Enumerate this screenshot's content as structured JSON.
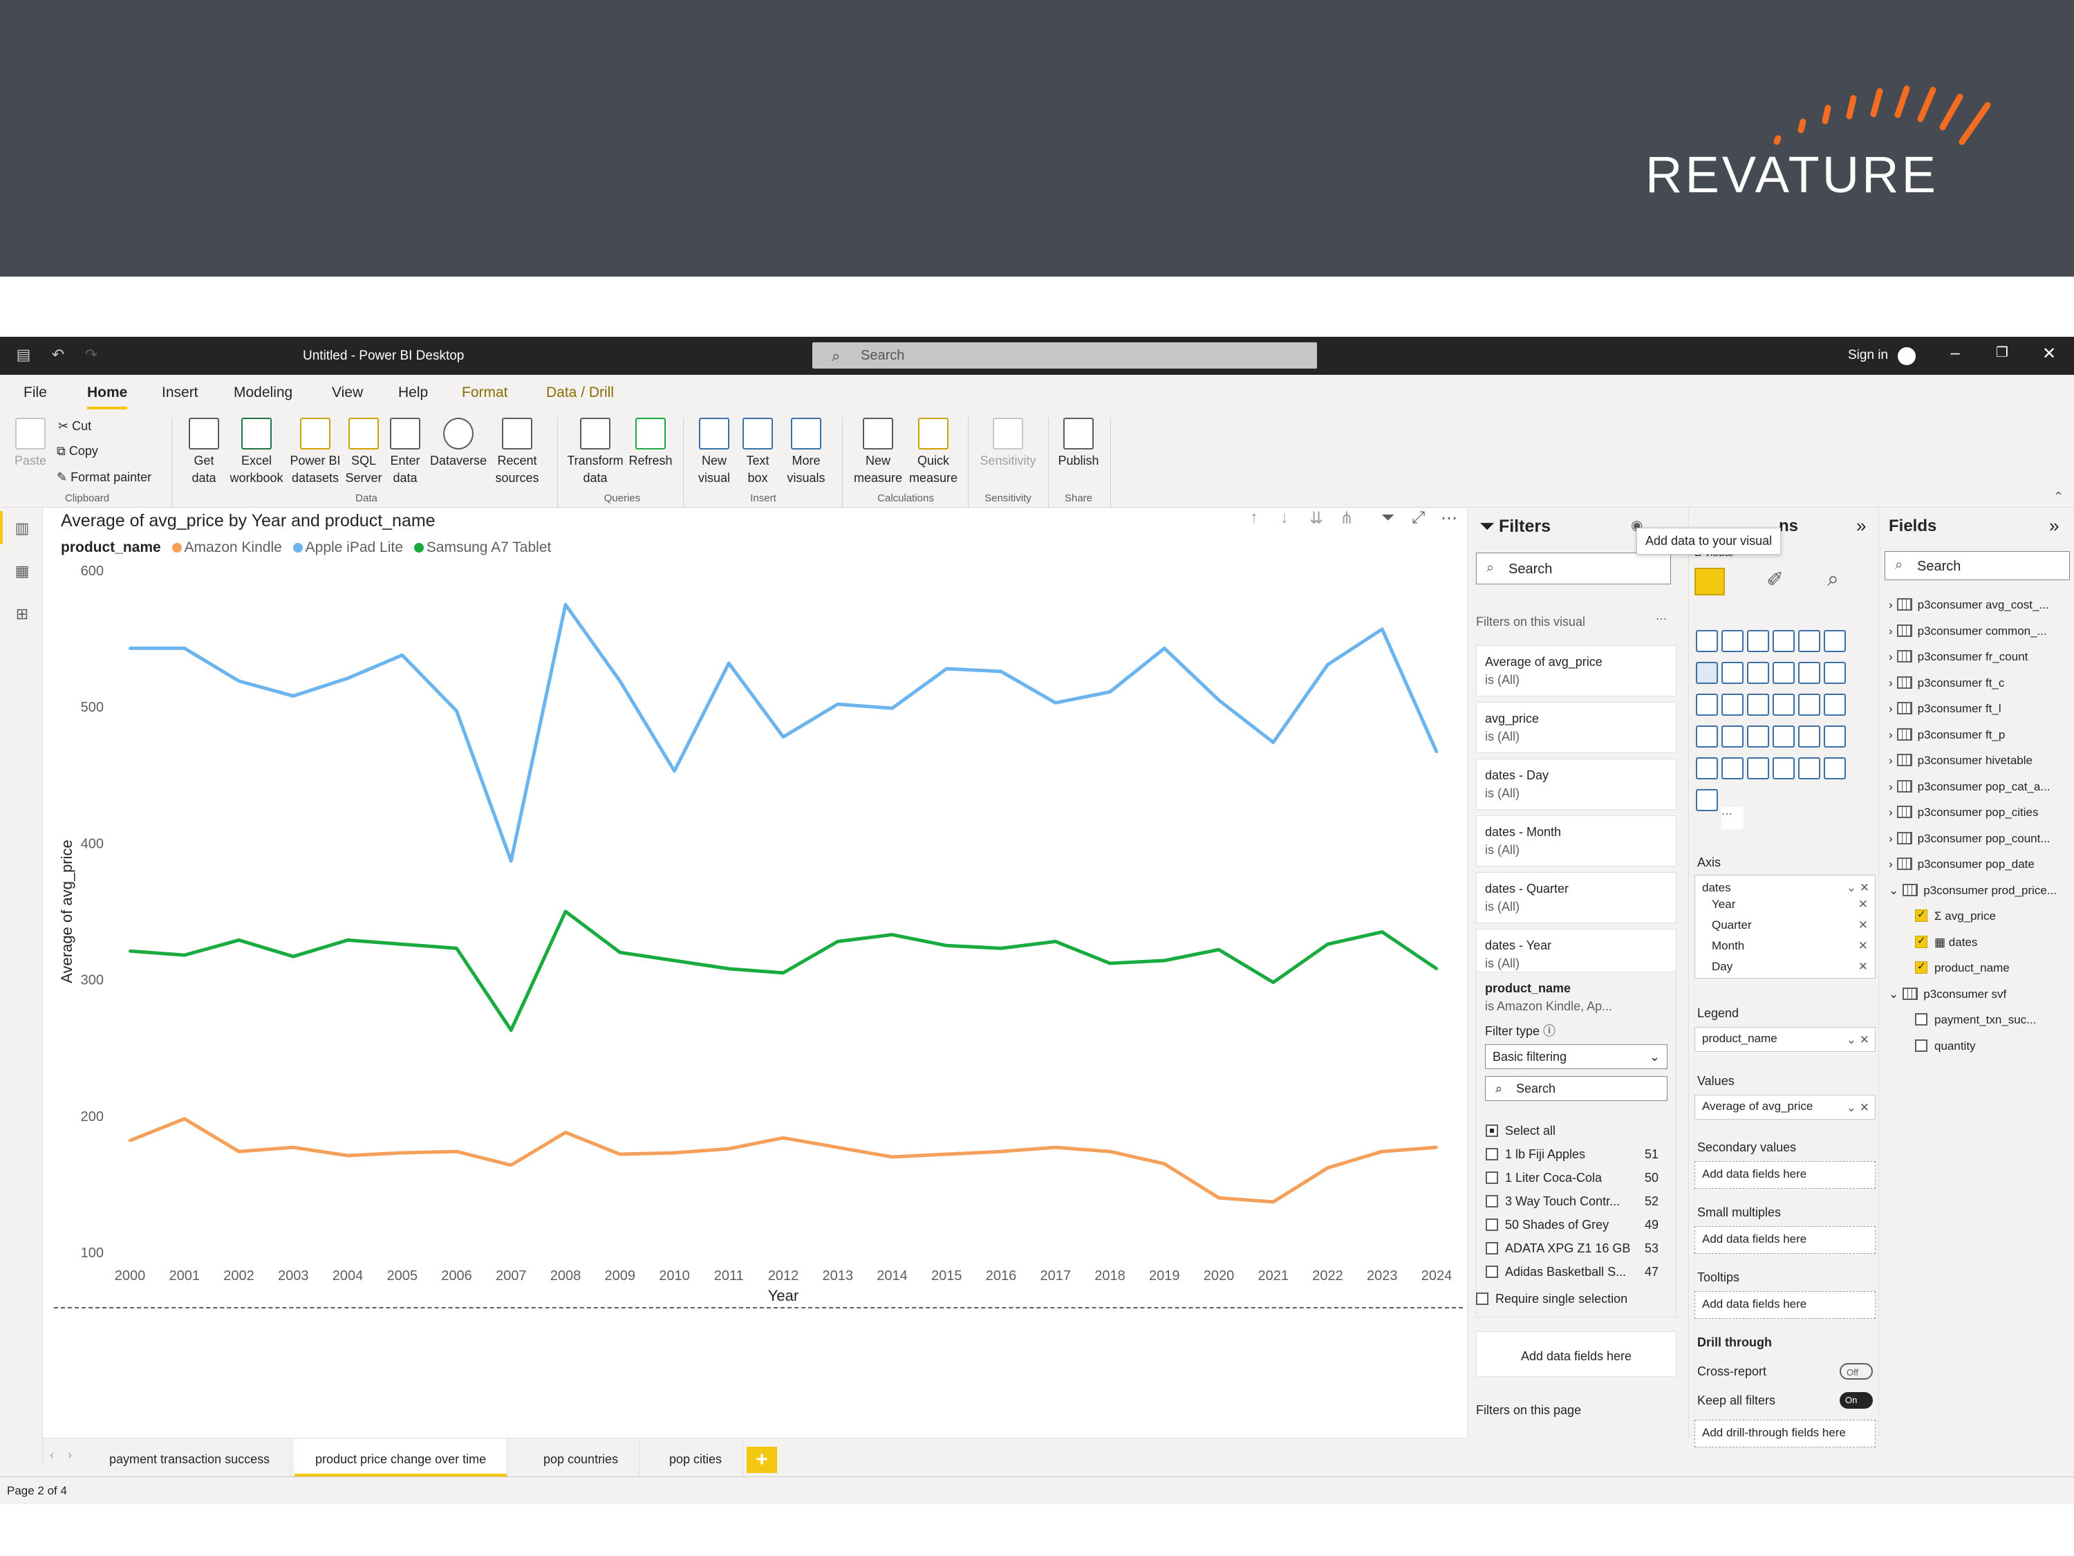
{
  "brand": {
    "name": "REVATURE",
    "colors": {
      "banner": "#464a52",
      "accent": "#f26d21"
    }
  },
  "titlebar": {
    "title": "Untitled - Power BI Desktop",
    "search_placeholder": "Search",
    "signin": "Sign in"
  },
  "menu": {
    "tabs": [
      "File",
      "Home",
      "Insert",
      "Modeling",
      "View",
      "Help",
      "Format",
      "Data / Drill"
    ],
    "active": "Home"
  },
  "ribbon": {
    "clipboard": {
      "paste": "Paste",
      "cut": "Cut",
      "copy": "Copy",
      "format_painter": "Format painter",
      "group": "Clipboard"
    },
    "data": {
      "items": [
        "Get data",
        "Excel workbook",
        "Power BI datasets",
        "SQL Server",
        "Enter data",
        "Dataverse",
        "Recent sources"
      ],
      "group": "Data"
    },
    "queries": {
      "items": [
        "Transform data",
        "Refresh"
      ],
      "group": "Queries"
    },
    "insert": {
      "items": [
        "New visual",
        "Text box",
        "More visuals"
      ],
      "group": "Insert"
    },
    "calculations": {
      "items": [
        "New measure",
        "Quick measure"
      ],
      "group": "Calculations"
    },
    "sensitivity": {
      "items": [
        "Sensitivity"
      ],
      "group": "Sensitivity"
    },
    "share": {
      "items": [
        "Publish"
      ],
      "group": "Share"
    }
  },
  "visual": {
    "title": "Average of avg_price by Year and product_name",
    "legend_title": "product_name",
    "legend_items": [
      "Amazon Kindle",
      "Apple iPad Lite",
      "Samsung A7 Tablet"
    ]
  },
  "chart_data": {
    "type": "line",
    "title": "Average of avg_price by Year and product_name",
    "xlabel": "Year",
    "ylabel": "Average of avg_price",
    "x": [
      2000,
      2001,
      2002,
      2003,
      2004,
      2005,
      2006,
      2007,
      2008,
      2009,
      2010,
      2011,
      2012,
      2013,
      2014,
      2015,
      2016,
      2017,
      2018,
      2019,
      2020,
      2021,
      2022,
      2023,
      2024
    ],
    "ylim": [
      100,
      600
    ],
    "yticks": [
      100,
      200,
      300,
      400,
      500,
      600
    ],
    "grid": false,
    "legend": "top-left",
    "series": [
      {
        "name": "Amazon Kindle",
        "color": "#f5a05a",
        "values": [
          182,
          198,
          174,
          177,
          171,
          173,
          174,
          164,
          188,
          172,
          173,
          176,
          184,
          177,
          170,
          172,
          174,
          177,
          174,
          165,
          140,
          137,
          162,
          174,
          177
        ]
      },
      {
        "name": "Apple iPad Lite",
        "color": "#6cb4ee",
        "values": [
          543,
          543,
          519,
          508,
          521,
          538,
          497,
          387,
          575,
          519,
          453,
          532,
          478,
          502,
          499,
          528,
          526,
          503,
          511,
          543,
          505,
          474,
          531,
          557,
          467
        ]
      },
      {
        "name": "Samsung A7 Tablet",
        "color": "#1aab40",
        "values": [
          321,
          318,
          329,
          317,
          329,
          326,
          323,
          263,
          350,
          320,
          314,
          308,
          305,
          328,
          333,
          325,
          323,
          328,
          312,
          314,
          322,
          298,
          326,
          335,
          308
        ]
      }
    ]
  },
  "filters": {
    "title": "Filters",
    "search": "Search",
    "on_visual": "Filters on this visual",
    "cards": [
      {
        "name": "Average of avg_price",
        "state": "is (All)"
      },
      {
        "name": "avg_price",
        "state": "is (All)"
      },
      {
        "name": "dates - Day",
        "state": "is (All)"
      },
      {
        "name": "dates - Month",
        "state": "is (All)"
      },
      {
        "name": "dates - Quarter",
        "state": "is (All)"
      },
      {
        "name": "dates - Year",
        "state": "is (All)"
      }
    ],
    "expanded": {
      "name": "product_name",
      "state": "is Amazon Kindle, Ap...",
      "filter_type_label": "Filter type",
      "filter_type": "Basic filtering",
      "search": "Search",
      "items": [
        {
          "label": "Select all",
          "count": ""
        },
        {
          "label": "1 lb Fiji Apples",
          "count": "51"
        },
        {
          "label": "1 Liter Coca-Cola",
          "count": "50"
        },
        {
          "label": "3 Way Touch Contr...",
          "count": "52"
        },
        {
          "label": "50 Shades of Grey",
          "count": "49"
        },
        {
          "label": "ADATA XPG Z1 16 GB",
          "count": "53"
        },
        {
          "label": "Adidas Basketball S...",
          "count": "47"
        }
      ],
      "require_single": "Require single selection"
    },
    "add_fields": "Add data fields here",
    "on_page": "Filters on this page"
  },
  "visualizations": {
    "title_fragment": "ns",
    "build_fragment": "B    visual",
    "tooltip": "Add data to your visual",
    "axis_label": "Axis",
    "axis_field": "dates",
    "axis_children": [
      "Year",
      "Quarter",
      "Month",
      "Day"
    ],
    "legend_label": "Legend",
    "legend_field": "product_name",
    "values_label": "Values",
    "values_field": "Average of avg_price",
    "secondary_label": "Secondary values",
    "small_multiples_label": "Small multiples",
    "tooltips_label": "Tooltips",
    "add_fields": "Add data fields here",
    "drill_label": "Drill through",
    "cross_report": "Cross-report",
    "cross_state": "Off",
    "keep_filters": "Keep all filters",
    "keep_state": "On",
    "add_drill": "Add drill-through fields here"
  },
  "fields": {
    "title": "Fields",
    "search": "Search",
    "tables": [
      "p3consumer avg_cost_...",
      "p3consumer common_...",
      "p3consumer fr_count",
      "p3consumer ft_c",
      "p3consumer ft_l",
      "p3consumer ft_p",
      "p3consumer hivetable",
      "p3consumer pop_cat_a...",
      "p3consumer pop_cities",
      "p3consumer pop_count...",
      "p3consumer pop_date",
      "p3consumer prod_price..."
    ],
    "prod_children": [
      "avg_price",
      "dates",
      "product_name"
    ],
    "svf_table": "p3consumer svf",
    "svf_children": [
      "payment_txn_suc...",
      "quantity"
    ]
  },
  "pages": {
    "tabs": [
      "payment transaction success",
      "product price change over time",
      "pop countries",
      "pop cities"
    ],
    "active_index": 1,
    "add": "+"
  },
  "status": {
    "page": "Page 2 of 4"
  }
}
